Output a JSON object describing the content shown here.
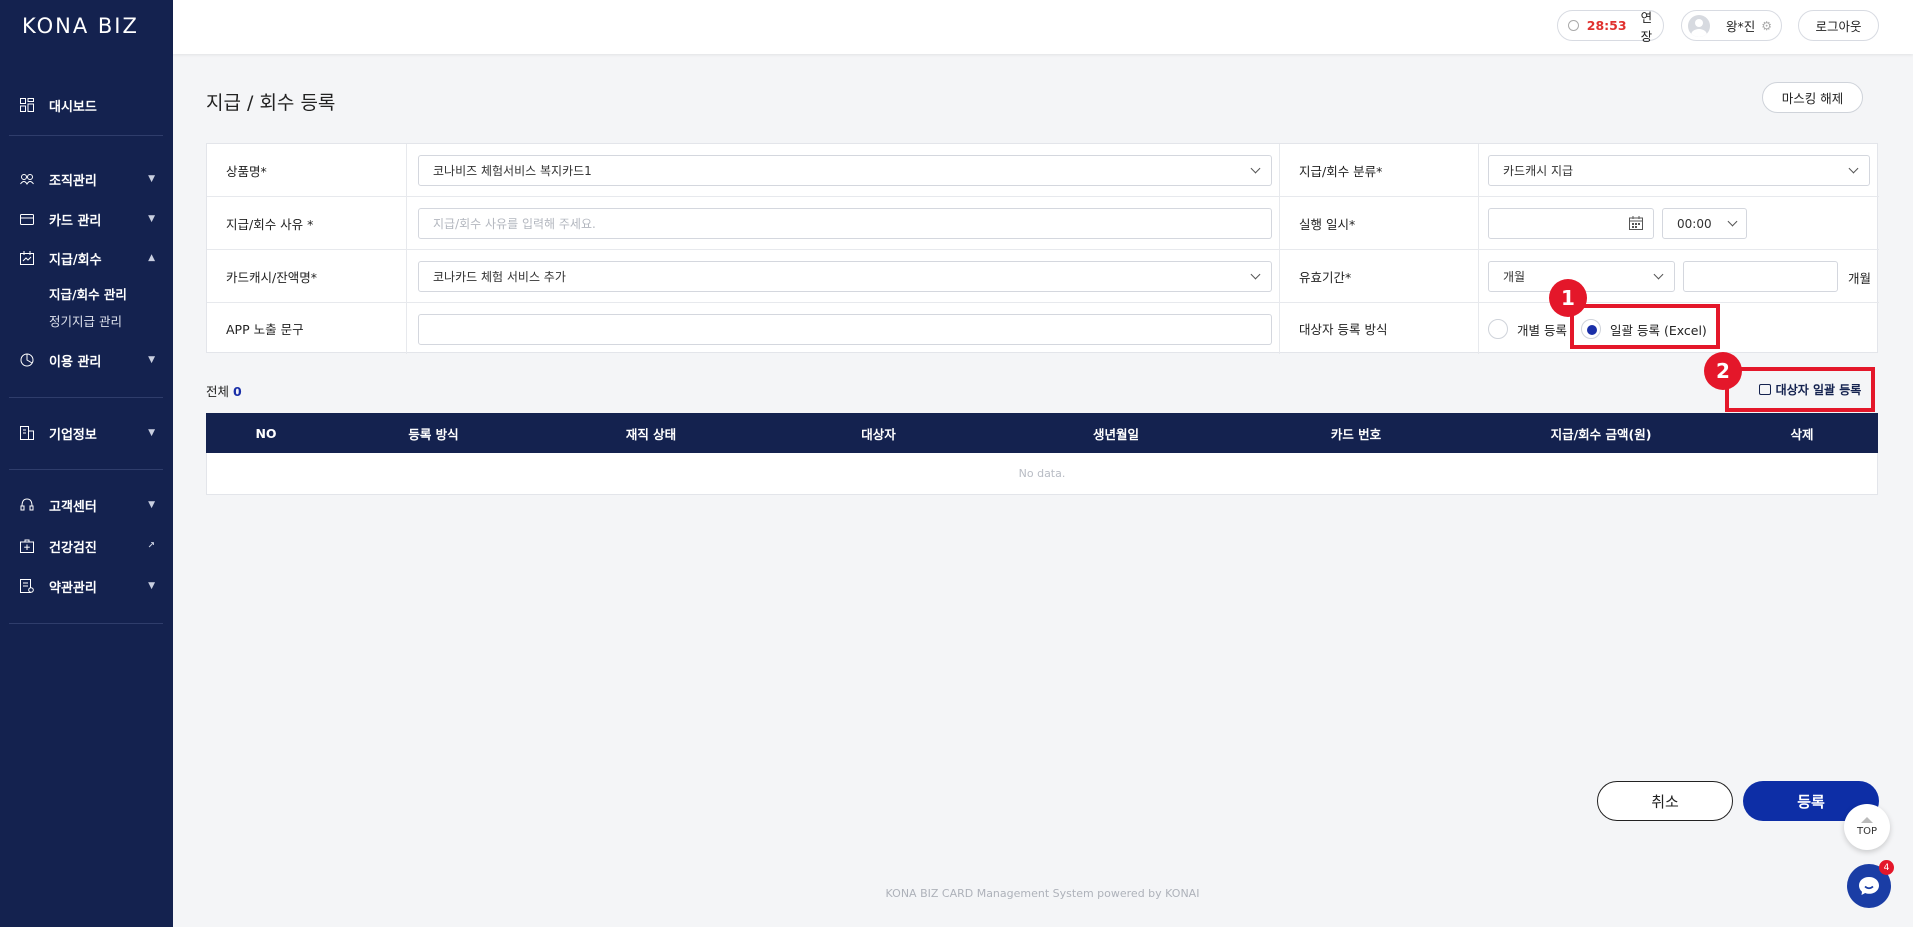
{
  "app": {
    "logo": "KONA BIZ"
  },
  "sidebar": {
    "items": [
      {
        "label": "대시보드",
        "icon": "dashboard-icon"
      },
      {
        "label": "조직관리",
        "icon": "organization-icon"
      },
      {
        "label": "카드 관리",
        "icon": "card-icon"
      },
      {
        "label": "지급/회수",
        "icon": "payment-icon"
      },
      {
        "label": "이용 관리",
        "icon": "usage-icon"
      },
      {
        "label": "기업정보",
        "icon": "building-icon"
      },
      {
        "label": "고객센터",
        "icon": "headset-icon"
      },
      {
        "label": "건강검진",
        "icon": "health-icon"
      },
      {
        "label": "약관관리",
        "icon": "document-icon"
      }
    ],
    "sub_items": [
      {
        "label": "지급/회수 관리"
      },
      {
        "label": "정기지급 관리"
      }
    ]
  },
  "header": {
    "timer": "28:53",
    "extend_label": "연장",
    "user_name": "왕*진",
    "logout_label": "로그아웃"
  },
  "page": {
    "title": "지급 / 회수 등록",
    "mask_button": "마스킹 해제"
  },
  "form": {
    "product_label": "상품명*",
    "product_value": "코나비즈 체험서비스 복지카드1",
    "category_label": "지급/회수 분류*",
    "category_value": "카드캐시 지급",
    "reason_label": "지급/회수 사유 *",
    "reason_placeholder": "지급/회수 사유를 입력해 주세요.",
    "exec_label": "실행 일시*",
    "exec_time": "00:00",
    "cash_label": "카드캐시/잔액명*",
    "cash_value": "코나카드 체험 서비스 추가",
    "validity_label": "유효기간*",
    "validity_unit_select": "개월",
    "validity_unit_label": "개월",
    "app_label": "APP 노출 문구",
    "target_label": "대상자 등록 방식",
    "radio_individual": "개별 등록",
    "radio_bulk": "일괄 등록 (Excel)"
  },
  "annotations": {
    "marker1": "1",
    "marker2": "2"
  },
  "list": {
    "total_label": "전체",
    "total_count": "0",
    "bulk_button": "대상자 일괄 등록",
    "columns": [
      "NO",
      "등록 방식",
      "재직 상태",
      "대상자",
      "생년월일",
      "카드 번호",
      "지급/회수 금액(원)",
      "삭제"
    ],
    "empty_text": "No data."
  },
  "actions": {
    "cancel": "취소",
    "submit": "등록",
    "top": "TOP",
    "chat_badge": "4"
  },
  "footer": "KONA BIZ CARD Management System powered by KONAI",
  "colors": {
    "sidebar": "#14224f",
    "accent": "#0d2ea6",
    "highlight": "#e4172a"
  }
}
